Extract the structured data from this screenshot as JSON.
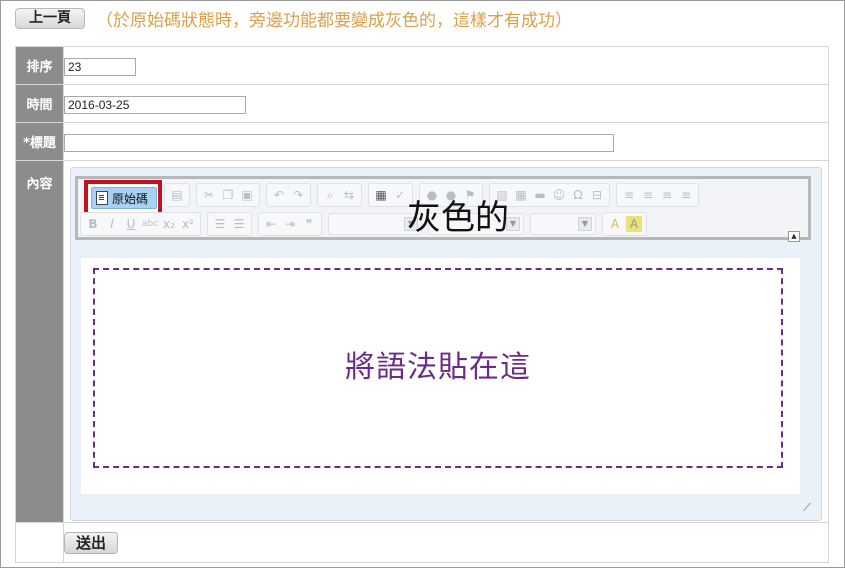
{
  "header": {
    "back_label": "上一頁",
    "note": "（於原始碼狀態時，旁邊功能都要變成灰色的，這樣才有成功）"
  },
  "form": {
    "order_label": "排序",
    "order_value": "23",
    "date_label": "時間",
    "date_value": "2016-03-25",
    "title_label": "*標題",
    "title_value": "",
    "content_label": "內容",
    "submit_label": "送出"
  },
  "editor": {
    "source_label": "原始碼",
    "gray_annotation": "灰色的",
    "paste_hint": "將語法貼在這",
    "accent_colors": {
      "highlight_border": "#c1121f",
      "paste_zone": "#6a2c86",
      "note_text": "#d8a04b"
    },
    "toolbar_icons_row1": [
      "newpage-icon",
      "cut-icon",
      "copy-icon",
      "paste-icon",
      "undo-icon",
      "redo-icon",
      "find-icon",
      "replace-icon",
      "selectall-icon",
      "spellcheck-icon",
      "link-icon",
      "unlink-icon",
      "anchor-icon",
      "image-icon",
      "table-icon",
      "hr-icon",
      "smiley-icon",
      "special-char-icon",
      "pagebreak-icon",
      "align-left-icon",
      "align-center-icon",
      "align-right-icon",
      "justify-icon"
    ],
    "toolbar_icons_row2": [
      "bold-icon",
      "italic-icon",
      "underline-icon",
      "strike-icon",
      "subscript-icon",
      "superscript-icon",
      "numbered-list-icon",
      "bulleted-list-icon",
      "outdent-icon",
      "indent-icon",
      "blockquote-icon",
      "text-color-icon",
      "bg-color-icon"
    ]
  }
}
